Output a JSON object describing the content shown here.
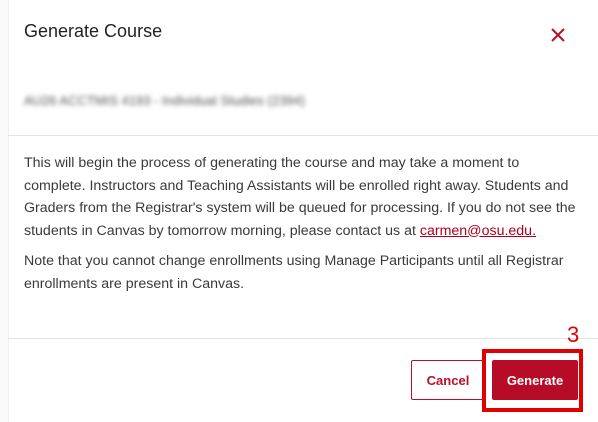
{
  "dialog": {
    "title": "Generate Course",
    "close_icon": "close-icon",
    "course_name": "AU26 ACCTMIS 4193 - Individual Studies (2394)",
    "body": {
      "paragraph_before_link": "This will begin the process of generating the course and may take a moment to complete. Instructors and Teaching Assistants will be enrolled right away. Students and Graders from the Registrar's system will be queued for processing. If you do not see the students in Canvas by tomorrow morning, please contact us at ",
      "email": "carmen@osu.edu.",
      "note": "Note that you cannot change enrollments using Manage Participants until all Registrar enrollments are present in Canvas."
    },
    "buttons": {
      "cancel_label": "Cancel",
      "generate_label": "Generate"
    }
  },
  "annotation": {
    "step_number": "3"
  },
  "colors": {
    "brand_red": "#b70c28",
    "annotation_red": "#e00000"
  }
}
